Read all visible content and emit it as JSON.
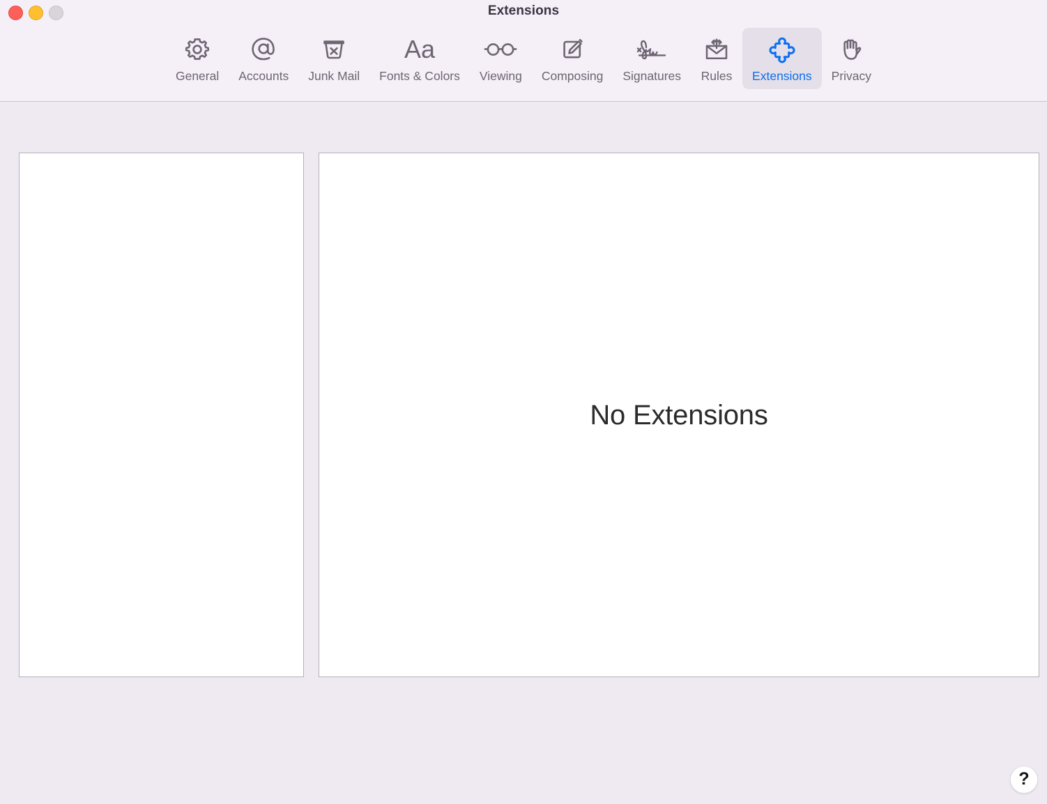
{
  "window": {
    "title": "Extensions",
    "traffic_lights": [
      {
        "name": "close",
        "color": "#fc6058"
      },
      {
        "name": "minimize",
        "color": "#fec02f"
      },
      {
        "name": "zoom",
        "color": "#d8d4da"
      }
    ]
  },
  "toolbar": {
    "tabs": [
      {
        "label": "General",
        "icon": "gear-icon",
        "selected": false
      },
      {
        "label": "Accounts",
        "icon": "at-sign-icon",
        "selected": false
      },
      {
        "label": "Junk Mail",
        "icon": "trash-x-icon",
        "selected": false
      },
      {
        "label": "Fonts & Colors",
        "icon": "aa-text-icon",
        "selected": false
      },
      {
        "label": "Viewing",
        "icon": "eyeglasses-icon",
        "selected": false
      },
      {
        "label": "Composing",
        "icon": "compose-pencil-icon",
        "selected": false
      },
      {
        "label": "Signatures",
        "icon": "signature-icon",
        "selected": false
      },
      {
        "label": "Rules",
        "icon": "envelope-arrows-icon",
        "selected": false
      },
      {
        "label": "Extensions",
        "icon": "puzzle-piece-icon",
        "selected": true
      },
      {
        "label": "Privacy",
        "icon": "raised-hand-icon",
        "selected": false
      }
    ]
  },
  "main": {
    "extensions_list": {
      "items": []
    },
    "detail": {
      "empty_message": "No Extensions"
    }
  },
  "help": {
    "label": "?"
  },
  "colors": {
    "toolbar_background": "#f5eff8",
    "content_background": "#efeaf1",
    "panel_background": "#ffffff",
    "panel_border": "#b3afb6",
    "tab_label": "#6d6672",
    "tab_selected_label": "#0b70ef",
    "tab_selected_background": "#e5dfe9",
    "title_text": "#3a3540",
    "empty_message_text": "#2b2b2d"
  }
}
